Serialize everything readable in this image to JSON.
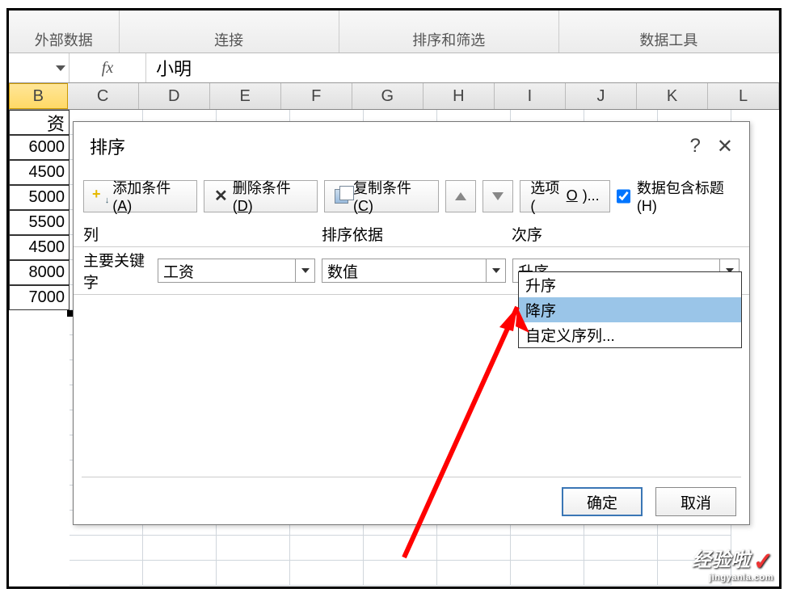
{
  "ribbon": {
    "groups": [
      "外部数据",
      "连接",
      "排序和筛选",
      "数据工具"
    ]
  },
  "formula_bar": {
    "fx_label": "fx",
    "value": "小明"
  },
  "columns": [
    "B",
    "C",
    "D",
    "E",
    "F",
    "G",
    "H",
    "I",
    "J",
    "K",
    "L"
  ],
  "cell_b_header": "资",
  "data_values": [
    "6000",
    "4500",
    "5000",
    "5500",
    "4500",
    "8000",
    "7000"
  ],
  "dialog": {
    "title": "排序",
    "help": "?",
    "toolbar": {
      "add": "添加条件(A)",
      "del": "删除条件(D)",
      "copy": "复制条件(C)",
      "options": "选项(O)...",
      "header_check": "数据包含标题(H)"
    },
    "headers": {
      "col": "列",
      "basis": "排序依据",
      "order": "次序"
    },
    "row": {
      "keylabel": "主要关键字",
      "key": "工资",
      "basis": "数值",
      "order": "升序"
    },
    "dropdown": {
      "asc": "升序",
      "desc": "降序",
      "custom": "自定义序列..."
    },
    "ok": "确定",
    "cancel": "取消"
  },
  "watermark": {
    "main": "经验啦",
    "sub": "jingyanla.com"
  }
}
